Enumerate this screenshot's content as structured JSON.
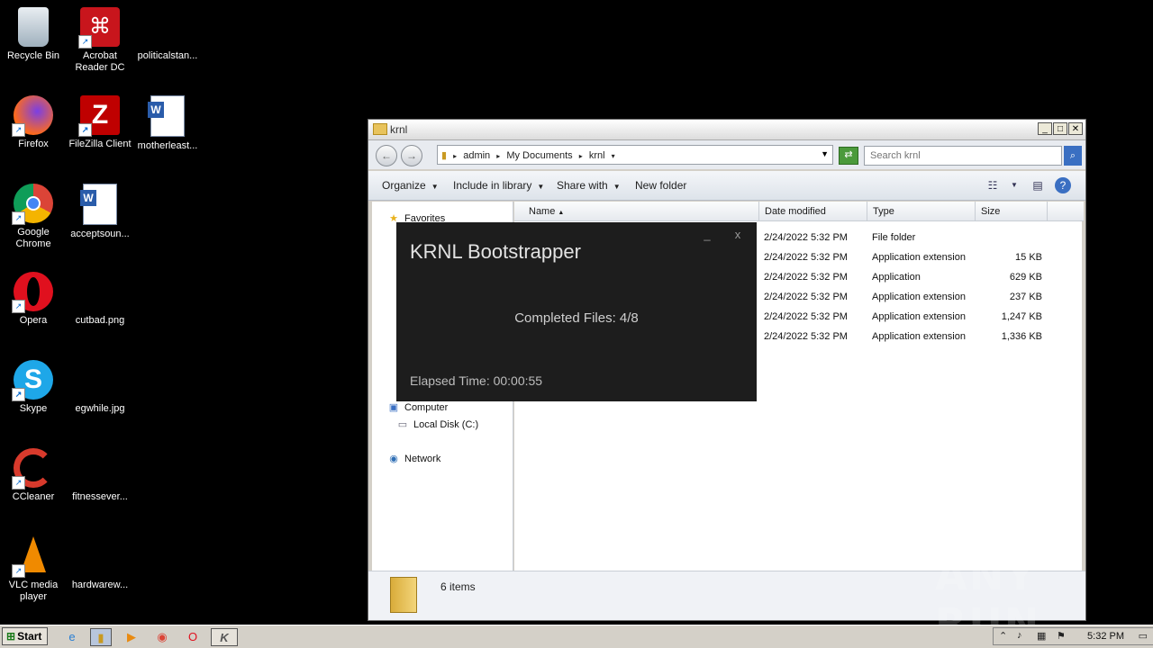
{
  "desktop": {
    "icons": [
      {
        "label": "Recycle Bin"
      },
      {
        "label": "Acrobat Reader DC"
      },
      {
        "label": "politicalstan..."
      },
      {
        "label": "Firefox"
      },
      {
        "label": "FileZilla Client"
      },
      {
        "label": "motherleast..."
      },
      {
        "label": "Google Chrome"
      },
      {
        "label": "acceptsoun..."
      },
      {
        "label": "Opera"
      },
      {
        "label": "cutbad.png"
      },
      {
        "label": "Skype"
      },
      {
        "label": "egwhile.jpg"
      },
      {
        "label": "CCleaner"
      },
      {
        "label": "fitnessever..."
      },
      {
        "label": "VLC media player"
      },
      {
        "label": "hardwarew..."
      }
    ]
  },
  "explorer": {
    "title": "krnl",
    "breadcrumbs": [
      "admin",
      "My Documents",
      "krnl"
    ],
    "search_placeholder": "Search krnl",
    "toolbar": {
      "organize": "Organize",
      "include_in_library": "Include in library",
      "share_with": "Share with",
      "new_folder": "New folder"
    },
    "nav": {
      "favorites": "Favorites",
      "computer": "Computer",
      "local_disk": "Local Disk (C:)",
      "network": "Network"
    },
    "columns": {
      "name": "Name",
      "date": "Date modified",
      "type": "Type",
      "size": "Size"
    },
    "rows": [
      {
        "date": "2/24/2022 5:32 PM",
        "type": "File folder",
        "size": ""
      },
      {
        "date": "2/24/2022 5:32 PM",
        "type": "Application extension",
        "size": "15 KB"
      },
      {
        "date": "2/24/2022 5:32 PM",
        "type": "Application",
        "size": "629 KB"
      },
      {
        "date": "2/24/2022 5:32 PM",
        "type": "Application extension",
        "size": "237 KB"
      },
      {
        "date": "2/24/2022 5:32 PM",
        "type": "Application extension",
        "size": "1,247 KB"
      },
      {
        "date": "2/24/2022 5:32 PM",
        "type": "Application extension",
        "size": "1,336 KB"
      }
    ],
    "details": {
      "count": "6 items"
    }
  },
  "krnl": {
    "title": "KRNL Bootstrapper",
    "minimize": "_",
    "close": "x",
    "status": "Completed Files: 4/8",
    "elapsed": "Elapsed Time: 00:00:55"
  },
  "taskbar": {
    "start": "Start",
    "clock": "5:32 PM"
  },
  "watermark": "ANY RUN"
}
